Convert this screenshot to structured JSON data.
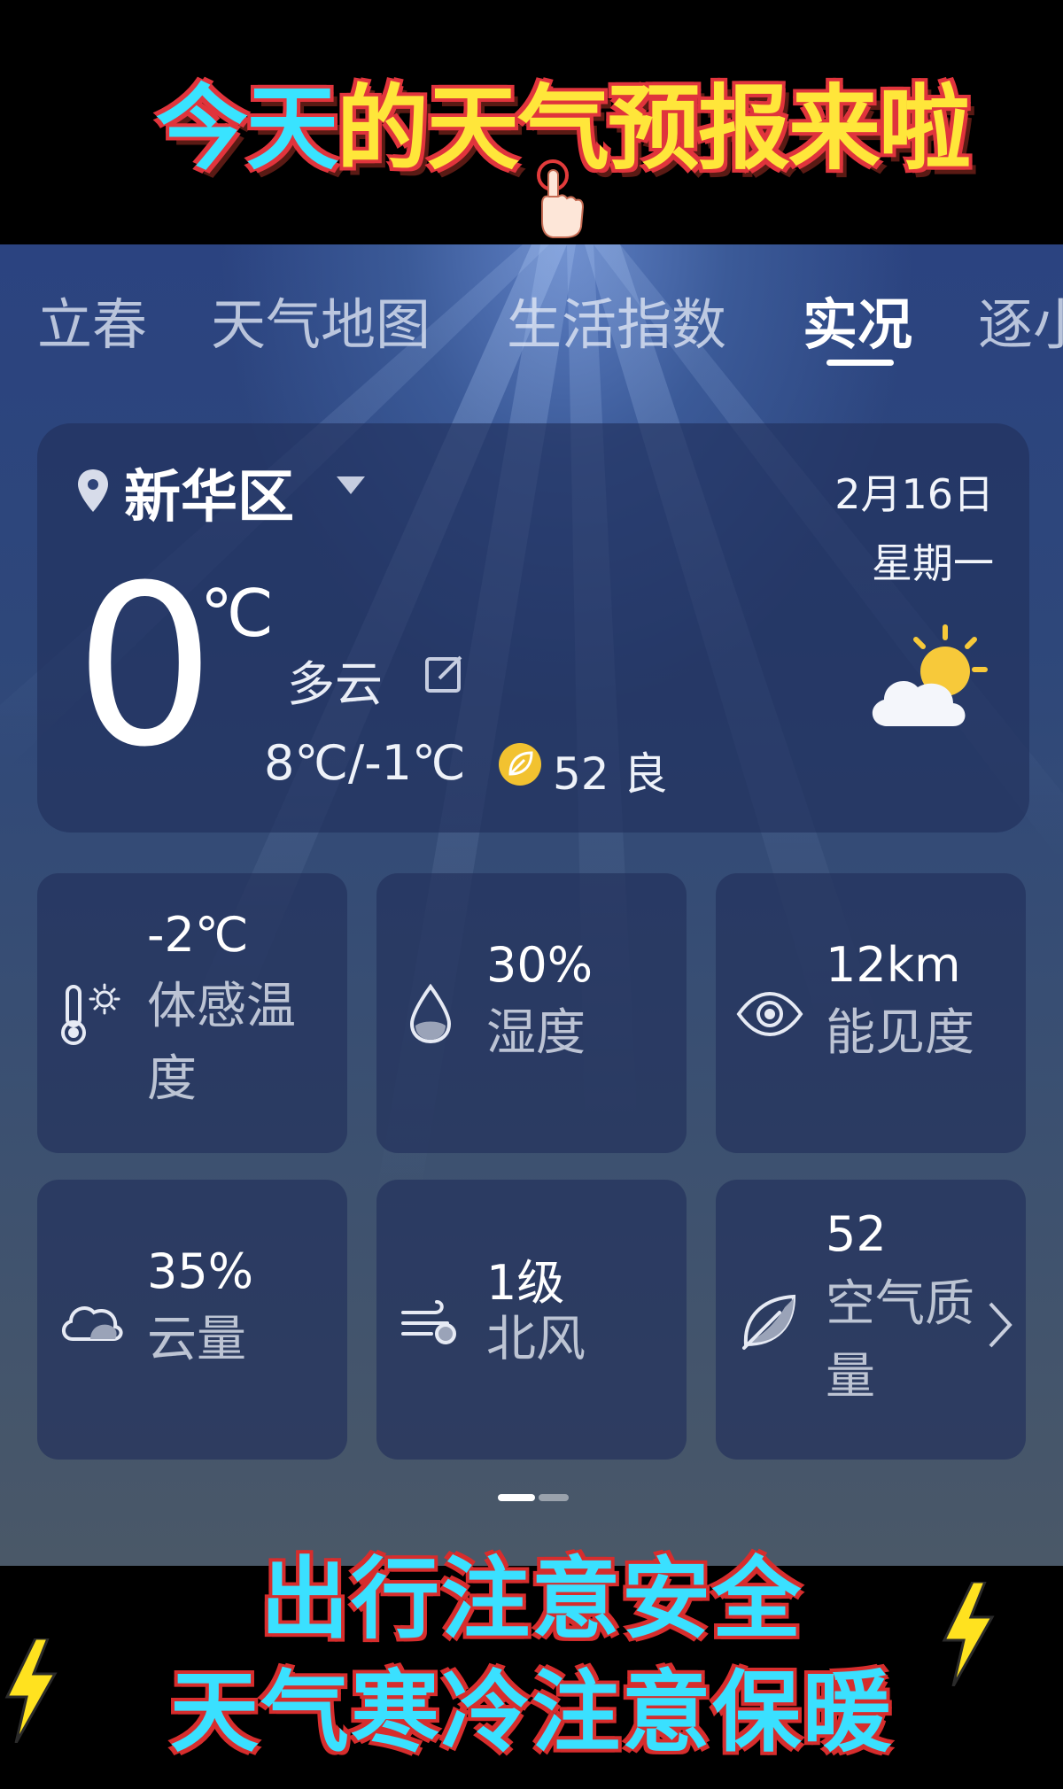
{
  "banner": {
    "title_part1": "今天",
    "title_part2": "的天气预报来啦"
  },
  "tabs": [
    {
      "label": "立春"
    },
    {
      "label": "天气地图"
    },
    {
      "label": "生活指数"
    },
    {
      "label": "实况",
      "active": true
    },
    {
      "label": "逐小"
    }
  ],
  "current": {
    "location": "新华区",
    "date": "2月16日",
    "weekday": "星期一",
    "temperature": "0",
    "unit": "℃",
    "condition": "多云",
    "high_low": "8℃/-1℃",
    "aqi": "52 良",
    "weather_icon": "partly-cloudy-sun-icon"
  },
  "details": [
    {
      "value": "-2℃",
      "label": "体感温度",
      "icon": "thermometer-sun-icon"
    },
    {
      "value": "30%",
      "label": "湿度",
      "icon": "water-drop-icon"
    },
    {
      "value": "12km",
      "label": "能见度",
      "icon": "eye-icon"
    },
    {
      "value": "35%",
      "label": "云量",
      "icon": "cloud-icon"
    },
    {
      "value": "1级",
      "label": "北风",
      "icon": "wind-icon"
    },
    {
      "value": "52",
      "label": "空气质量",
      "icon": "leaf-icon"
    }
  ],
  "captions": {
    "line1": "出行注意安全",
    "line2": "天气寒冷注意保暖"
  },
  "colors": {
    "caption_cyan": "#3ae0ff",
    "caption_outline": "#d62d2d",
    "title_yellow": "#ffe63a",
    "aqi_yellow": "#f2c230",
    "sun_yellow": "#f7c93a"
  }
}
